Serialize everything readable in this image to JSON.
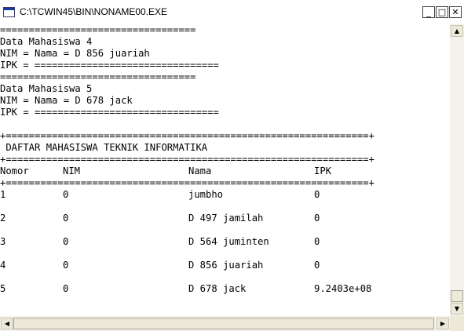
{
  "window": {
    "title": "C:\\TCWIN45\\BIN\\NONAME00.EXE",
    "controls": {
      "minimize": "_",
      "maximize": "□",
      "close": "✕"
    }
  },
  "console": {
    "sep_short": "==================================",
    "sep_med": "========================================",
    "record4": {
      "heading": "Data Mahasiswa 4",
      "nim_nama": "NIM = Nama = D 856 juariah",
      "ipk": "IPK = ================================"
    },
    "record5": {
      "heading": "Data Mahasiswa 5",
      "nim_nama": "NIM = Nama = D 678 jack",
      "ipk": "IPK = ================================"
    },
    "table_border": "+===============================================================+",
    "table_title": " DAFTAR MAHASISWA TEKNIK INFORMATIKA",
    "headers": [
      "Nomor",
      "NIM",
      "Nama",
      "IPK"
    ],
    "rows": [
      [
        "1",
        "0",
        "jumbho",
        "0"
      ],
      [
        "2",
        "0",
        "D 497 jamilah",
        "0"
      ],
      [
        "3",
        "0",
        "D 564 juminten",
        "0"
      ],
      [
        "4",
        "0",
        "D 856 juariah",
        "0"
      ],
      [
        "5",
        "0",
        "D 678 jack",
        "9.2403e+08"
      ]
    ]
  },
  "scrollbars": {
    "up_arrow": "▲",
    "down_arrow": "▼",
    "left_arrow": "◀",
    "right_arrow": "▶"
  }
}
